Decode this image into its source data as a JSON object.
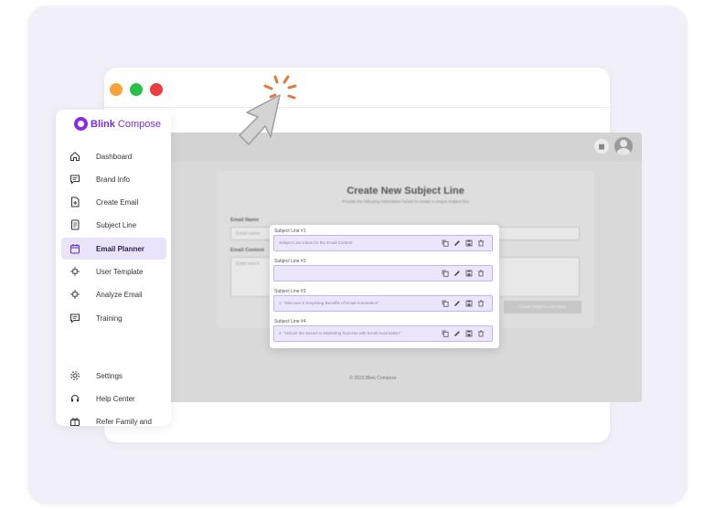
{
  "window": {
    "traffic_lights": [
      {
        "name": "minimize",
        "color": "#f7a23b"
      },
      {
        "name": "maximize",
        "color": "#2bbf4a"
      },
      {
        "name": "close",
        "color": "#ea3d3d"
      }
    ]
  },
  "brand": {
    "bold": "Blink",
    "rest": "Compose",
    "color": "#7b2cdf"
  },
  "sidebar": {
    "items": [
      {
        "label": "Dashboard",
        "icon": "home-icon"
      },
      {
        "label": "Brand Info",
        "icon": "chat-icon"
      },
      {
        "label": "Create Email",
        "icon": "file-plus-icon"
      },
      {
        "label": "Subject Line",
        "icon": "document-icon"
      },
      {
        "label": "Email Planner",
        "icon": "calendar-icon",
        "active": true
      },
      {
        "label": "User Template",
        "icon": "move-icon"
      },
      {
        "label": "Analyze Email",
        "icon": "move-icon"
      },
      {
        "label": "Training",
        "icon": "chat-icon"
      }
    ],
    "bottom_items": [
      {
        "label": "Settings",
        "icon": "gear-icon"
      },
      {
        "label": "Help Center",
        "icon": "headset-icon"
      },
      {
        "label": "Refer Family and",
        "icon": "gift-icon"
      }
    ]
  },
  "main": {
    "title": "Create New Subject Line",
    "subtitle": "Provide the following information below to create a unique subject line",
    "email_name_label": "Email Name",
    "email_name_placeholder": "Email name",
    "email_content_label": "Email Content",
    "email_content_placeholder": "Enter text h",
    "generate_button": "Create Subject Line Ideas",
    "footer": "© 2023 Blink Compose"
  },
  "popup": {
    "subject_lines": [
      {
        "label": "Subject Line #1",
        "text": "Subject Line Ideas for the Email Content"
      },
      {
        "label": "Subject Line #2",
        "text": ""
      },
      {
        "label": "Subject Line #3",
        "text": "1. \"Discover 5 Surprising Benefits of Email Automation\""
      },
      {
        "label": "Subject Line #4",
        "text": "2. \"Unlock the Secret to Marketing Success with Email Automation\""
      }
    ],
    "actions": [
      "copy-icon",
      "edit-icon",
      "save-icon",
      "delete-icon"
    ]
  },
  "colors": {
    "accent": "#7b2cdf",
    "active_bg": "#eae4fb",
    "cursor_click": "#e07a45"
  }
}
